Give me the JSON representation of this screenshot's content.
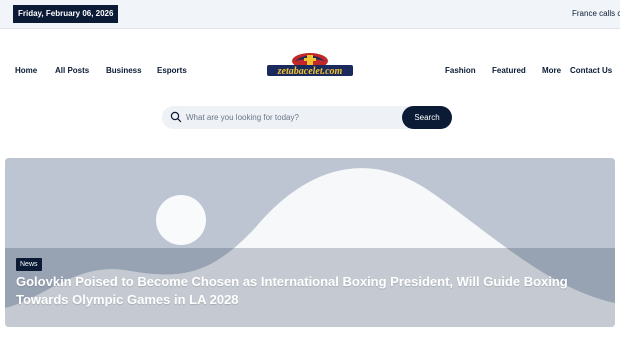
{
  "topbar": {
    "date": "Friday, February 06, 2026",
    "ticker": "France calls c"
  },
  "nav": {
    "left": [
      "Home",
      "All Posts",
      "Business",
      "Esports"
    ],
    "right": [
      "Fashion",
      "Featured",
      "More",
      "Contact Us"
    ]
  },
  "logo": {
    "text": "zetabacelet.com"
  },
  "search": {
    "placeholder": "What are you looking for today?",
    "button": "Search",
    "icon": "search-icon"
  },
  "featured": {
    "category": "News",
    "title": "Golovkin Poised to Become Chosen as International Boxing President, Will Guide Boxing Towards Olympic Games in LA 2028"
  },
  "colors": {
    "navy": "#0b1b36",
    "placeholder_bg": "#bdc6d2",
    "topbar_bg": "#f1f4f8"
  }
}
